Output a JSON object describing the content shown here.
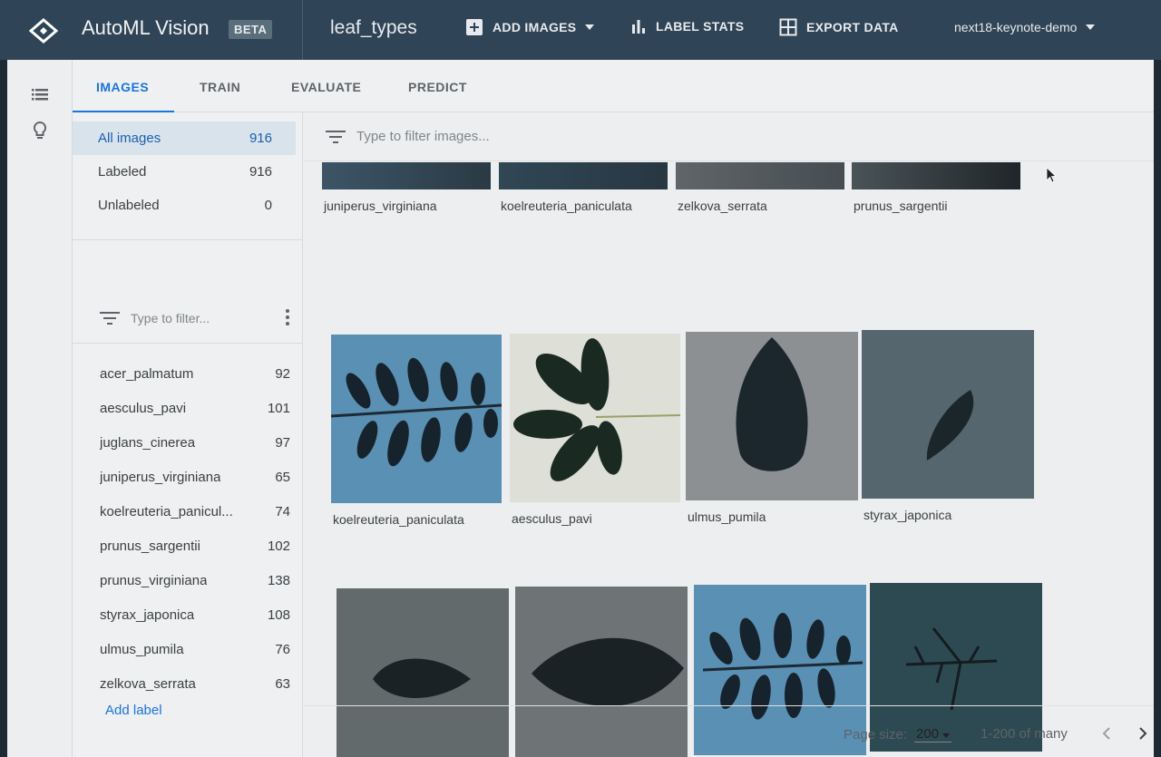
{
  "app": {
    "name": "AutoML Vision",
    "badge": "BETA",
    "dataset": "leaf_types",
    "project": "next18-keynote-demo"
  },
  "toolbar": {
    "add_images": "ADD IMAGES",
    "label_stats": "LABEL STATS",
    "export_data": "EXPORT DATA"
  },
  "tabs": [
    "IMAGES",
    "TRAIN",
    "EVALUATE",
    "PREDICT"
  ],
  "categories": [
    {
      "label": "All images",
      "count": "916"
    },
    {
      "label": "Labeled",
      "count": "916"
    },
    {
      "label": "Unlabeled",
      "count": "0"
    }
  ],
  "label_filter": {
    "placeholder": "Type to filter..."
  },
  "labels": [
    {
      "name": "acer_palmatum",
      "count": "92"
    },
    {
      "name": "aesculus_pavi",
      "count": "101"
    },
    {
      "name": "juglans_cinerea",
      "count": "97"
    },
    {
      "name": "juniperus_virginiana",
      "count": "65"
    },
    {
      "name": "koelreuteria_panicul...",
      "count": "74"
    },
    {
      "name": "prunus_sargentii",
      "count": "102"
    },
    {
      "name": "prunus_virginiana",
      "count": "138"
    },
    {
      "name": "styrax_japonica",
      "count": "108"
    },
    {
      "name": "ulmus_pumila",
      "count": "76"
    },
    {
      "name": "zelkova_serrata",
      "count": "63"
    }
  ],
  "add_label": "Add label",
  "image_filter": {
    "placeholder": "Type to filter images..."
  },
  "grid": {
    "row1": [
      "juniperus_virginiana",
      "koelreuteria_paniculata",
      "zelkova_serrata",
      "prunus_sargentii"
    ],
    "row2": [
      "koelreuteria_paniculata",
      "aesculus_pavi",
      "ulmus_pumila",
      "styrax_japonica"
    ],
    "row3": [
      "",
      "",
      "",
      ""
    ]
  },
  "pagination": {
    "page_size_label": "Page size:",
    "page_size": "200",
    "range": "1-200 of many"
  },
  "colors": {
    "topbar": "#2f4456",
    "accent": "#1a73e8",
    "panel_bg": "#eef0f1"
  }
}
